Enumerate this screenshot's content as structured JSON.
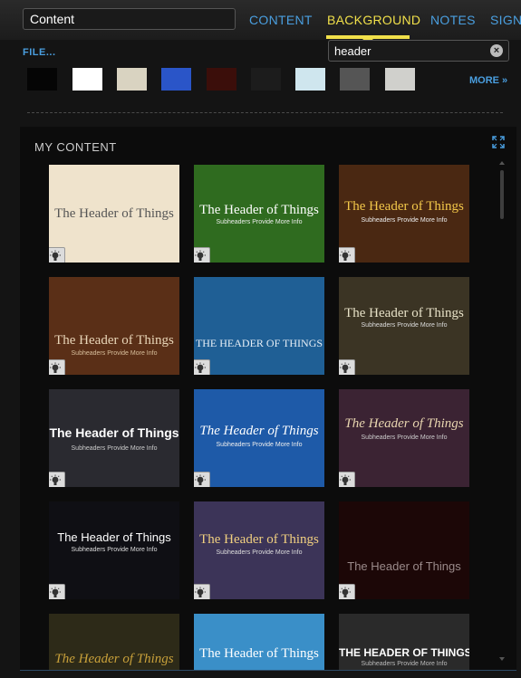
{
  "header": {
    "title_value": "Content",
    "tabs": [
      {
        "label": "CONTENT",
        "active": false
      },
      {
        "label": "BACKGROUND",
        "active": true
      },
      {
        "label": "NOTES",
        "active": false
      },
      {
        "label": "SIGNA",
        "active": false
      }
    ]
  },
  "toolbar": {
    "file_label": "FILE...",
    "search_value": "header",
    "clear_icon": "close-circle-icon",
    "more_label": "MORE »"
  },
  "swatches": [
    {
      "name": "black",
      "color": "#050505"
    },
    {
      "name": "white",
      "color": "#ffffff"
    },
    {
      "name": "parchment",
      "color": "#d9d3c1"
    },
    {
      "name": "blue",
      "color": "#2a55c8"
    },
    {
      "name": "red-texture",
      "color": "#3b0e0a"
    },
    {
      "name": "dark-texture",
      "color": "#1c1c1c"
    },
    {
      "name": "ice",
      "color": "#cfe6ee"
    },
    {
      "name": "gray",
      "color": "#555555"
    },
    {
      "name": "light-gray",
      "color": "#d0d0cc"
    }
  ],
  "my_content": {
    "title": "MY CONTENT",
    "thumbnails": [
      {
        "title": "The Header of Things",
        "subtitle": "",
        "bg": "#efe3cc",
        "title_color": "#555",
        "sub_color": "#777"
      },
      {
        "title": "The Header of Things",
        "subtitle": "Subheaders Provide More Info",
        "bg": "#2f6b1f",
        "title_color": "#fff",
        "sub_color": "#eee"
      },
      {
        "title": "The Header of Things",
        "subtitle": "Subheaders Provide More Info",
        "bg": "#4a2812",
        "title_color": "#f3c84a",
        "sub_color": "#eee"
      },
      {
        "title": "The Header of Things",
        "subtitle": "Subheaders Provide More Info",
        "bg": "#5a2f17",
        "title_color": "#e9d6b8",
        "sub_color": "#d8bf9c"
      },
      {
        "title": "THE HEADER OF THINGS",
        "subtitle": "",
        "bg": "#1f5f95",
        "title_color": "#e6eef6",
        "sub_color": "#ccc"
      },
      {
        "title": "The Header of Things",
        "subtitle": "Subheaders Provide More Info",
        "bg": "#3b3424",
        "title_color": "#e8e2c8",
        "sub_color": "#ddd"
      },
      {
        "title": "The Header of Things",
        "subtitle": "Subheaders Provide More Info",
        "bg": "#2a2a30",
        "title_color": "#fff",
        "sub_color": "#ccc"
      },
      {
        "title": "The Header of Things",
        "subtitle": "Subheaders Provide More Info",
        "bg": "#1e5aa8",
        "title_color": "#fff",
        "sub_color": "#eee"
      },
      {
        "title": "The Header of Things",
        "subtitle": "Subheaders Provide More Info",
        "bg": "#3b2333",
        "title_color": "#e9d6b0",
        "sub_color": "#ccc"
      },
      {
        "title": "The Header of Things",
        "subtitle": "Subheaders Provide More Info",
        "bg": "#0f0f14",
        "title_color": "#fff",
        "sub_color": "#ddd"
      },
      {
        "title": "The Header of Things",
        "subtitle": "Subheaders Provide More Info",
        "bg": "#3c3458",
        "title_color": "#f1d080",
        "sub_color": "#ddd"
      },
      {
        "title": "The Header of Things",
        "subtitle": "",
        "bg": "#1c0707",
        "title_color": "#9a8a8a",
        "sub_color": "#888"
      },
      {
        "title": "The Header of Things",
        "subtitle": "",
        "bg": "#2d2a18",
        "title_color": "#c8a03a",
        "sub_color": "#aaa"
      },
      {
        "title": "The Header of Things",
        "subtitle": "",
        "bg": "#3a8fc8",
        "title_color": "#fff",
        "sub_color": "#eee"
      },
      {
        "title": "THE HEADER OF THINGS",
        "subtitle": "Subheaders Provide More Info",
        "bg": "#2a2a2a",
        "title_color": "#fff",
        "sub_color": "#bbb"
      }
    ]
  },
  "colors": {
    "accent_blue": "#4a9fe0",
    "active_tab": "#f1e04a"
  }
}
